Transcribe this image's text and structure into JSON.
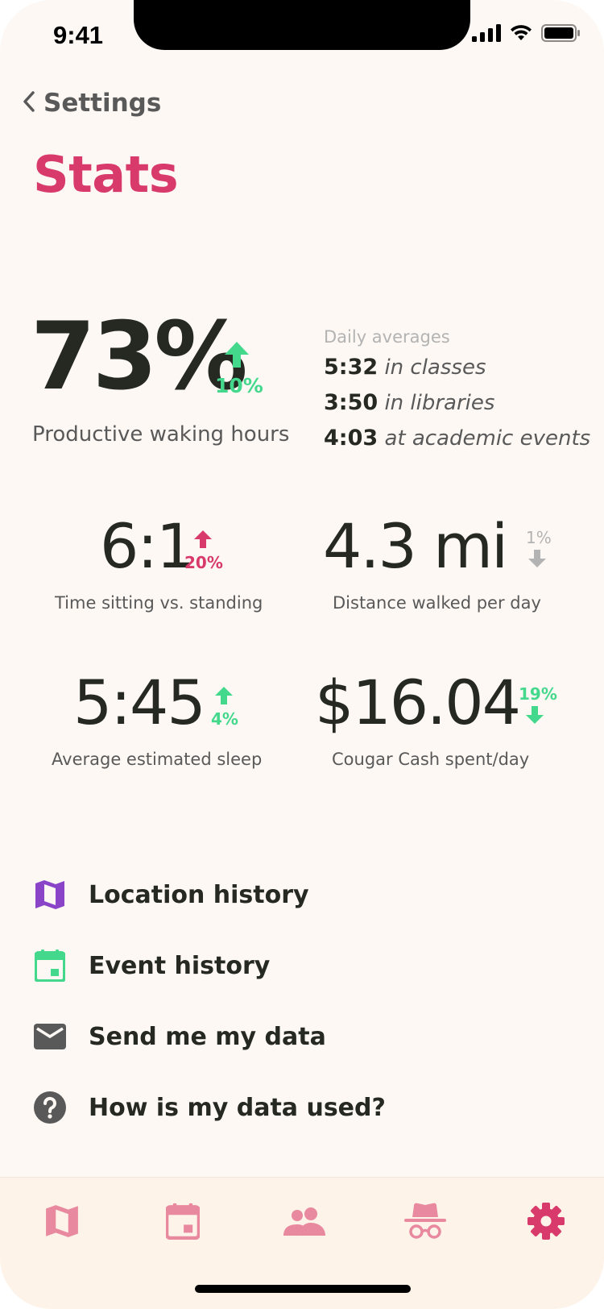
{
  "status_bar": {
    "time": "9:41"
  },
  "header": {
    "back_label": "Settings",
    "title": "Stats"
  },
  "productive": {
    "value": "73%",
    "change": "10%",
    "caption": "Productive waking hours"
  },
  "daily_averages": {
    "heading": "Daily averages",
    "items": [
      {
        "time": "5:32",
        "label": "in classes"
      },
      {
        "time": "3:50",
        "label": "in libraries"
      },
      {
        "time": "4:03",
        "label": "at academic events"
      }
    ]
  },
  "stats": {
    "sitting": {
      "value": "6:1",
      "change": "20%",
      "caption": "Time sitting vs. standing"
    },
    "distance": {
      "value": "4.3 mi",
      "change": "1%",
      "caption": "Distance walked per day"
    },
    "sleep": {
      "value": "5:45",
      "change": "4%",
      "caption": "Average estimated sleep"
    },
    "cash": {
      "value": "$16.04",
      "change": "19%",
      "caption": "Cougar Cash spent/day"
    }
  },
  "menu": {
    "location_history": "Location history",
    "event_history": "Event history",
    "send_data": "Send me my data",
    "data_usage": "How is my data used?"
  },
  "tabs": [
    {
      "icon": "map-icon"
    },
    {
      "icon": "calendar-icon"
    },
    {
      "icon": "people-icon"
    },
    {
      "icon": "incognito-icon"
    },
    {
      "icon": "gear-icon",
      "active": true
    }
  ],
  "colors": {
    "accent_pink": "#d83a6b",
    "tab_pink": "#e8899f",
    "up_green": "#44d88d",
    "muted_grey": "#b3b3b3",
    "map_purple": "#8a44c8",
    "background": "#fdf8f4"
  }
}
